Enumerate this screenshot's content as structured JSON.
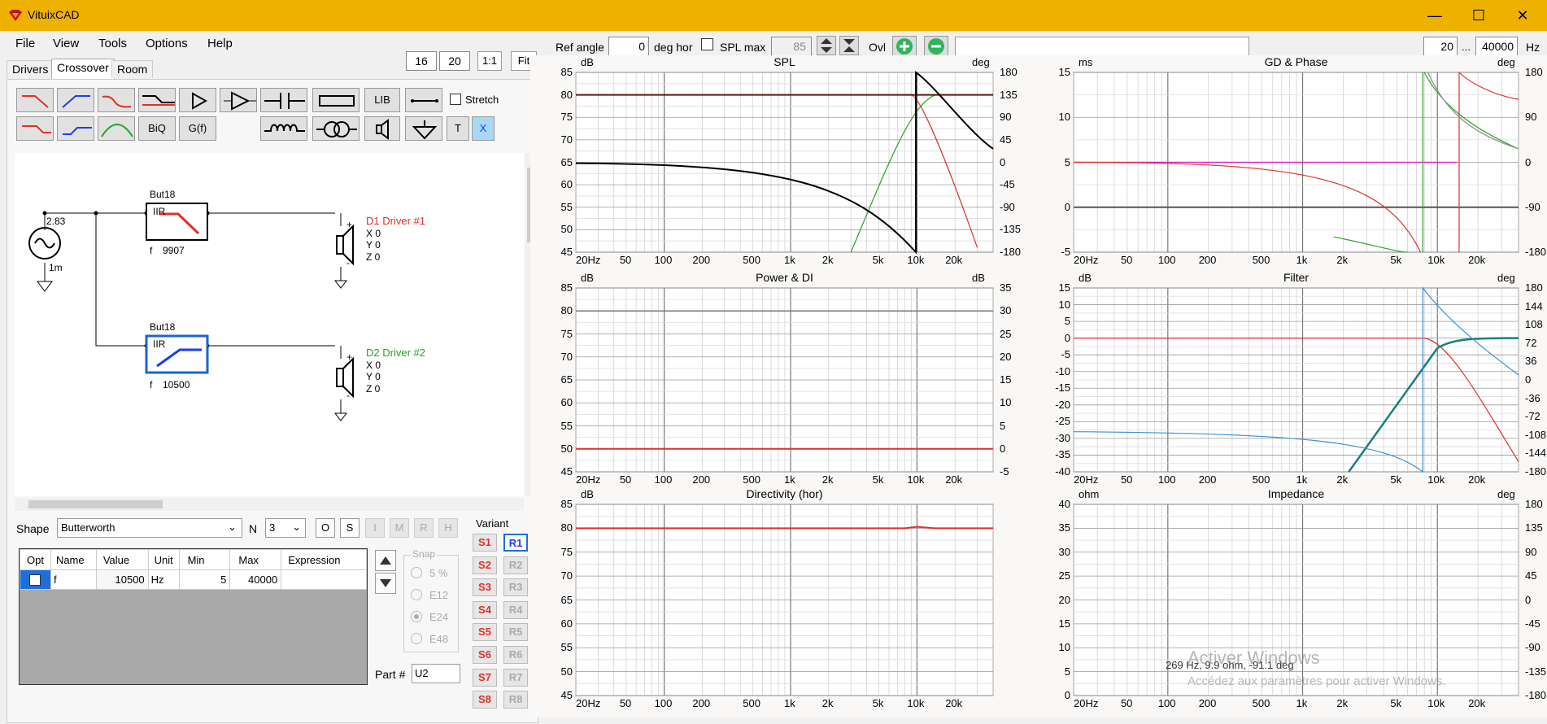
{
  "app": {
    "title": "VituixCAD"
  },
  "menu": [
    "File",
    "View",
    "Tools",
    "Options",
    "Help"
  ],
  "tabs": [
    "Drivers",
    "Crossover",
    "Room"
  ],
  "zoom": {
    "v1": "16",
    "v2": "20",
    "one": "1:1",
    "fit": "Fit"
  },
  "parts": {
    "lib": "LIB",
    "biq": "BiQ",
    "gf": "G(f)",
    "t": "T",
    "x": "X",
    "stretch": "Stretch"
  },
  "schematic": {
    "source_v": "2.83",
    "source_r": "1m",
    "block1": {
      "name": "But18",
      "type": "IIR",
      "f_label": "f",
      "f_value": "9907"
    },
    "block2": {
      "name": "But18",
      "type": "IIR",
      "f_label": "f",
      "f_value": "10500"
    },
    "driver1": {
      "name": "D1 Driver #1",
      "x": "X 0",
      "y": "Y 0",
      "z": "Z 0",
      "plus": "+",
      "minus": "-"
    },
    "driver2": {
      "name": "D2 Driver #2",
      "x": "X 0",
      "y": "Y 0",
      "z": "Z 0",
      "plus": "+",
      "minus": "-"
    }
  },
  "shape": {
    "label": "Shape",
    "value": "Butterworth",
    "n_label": "N",
    "n_value": "3",
    "btns": [
      "O",
      "S",
      "I",
      "M",
      "R",
      "H"
    ]
  },
  "table": {
    "headers": [
      "Opt",
      "Name",
      "Value",
      "Unit",
      "Min",
      "Max",
      "Expression"
    ],
    "row": {
      "name": "f",
      "value": "10500",
      "unit": "Hz",
      "min": "5",
      "max": "40000",
      "expr": ""
    }
  },
  "snap": {
    "label": "Snap",
    "options": [
      "5 %",
      "E12",
      "E24",
      "E48"
    ],
    "selected": "E24"
  },
  "part": {
    "label": "Part #",
    "value": "U2"
  },
  "variant": {
    "label": "Variant",
    "s": [
      "S1",
      "S2",
      "S3",
      "S4",
      "S5",
      "S6",
      "S7",
      "S8"
    ],
    "r": [
      "R1",
      "R2",
      "R3",
      "R4",
      "R5",
      "R6",
      "R7",
      "R8"
    ]
  },
  "top": {
    "ref_angle_label": "Ref angle",
    "ref_angle": "0",
    "deg_hor": "deg hor",
    "spl_max_label": "SPL max",
    "spl_max": "85",
    "ovl": "Ovl",
    "f_min": "20",
    "ellipsis": "...",
    "f_max": "40000",
    "hz": "Hz"
  },
  "x_ticks": [
    "20Hz",
    "50",
    "100",
    "200",
    "500",
    "1k",
    "2k",
    "5k",
    "10k",
    "20k"
  ],
  "panels": {
    "spl": {
      "title": "SPL",
      "lunit": "dB",
      "runit": "deg",
      "left": [
        "85",
        "80",
        "75",
        "70",
        "65",
        "60",
        "55",
        "50",
        "45"
      ],
      "right": [
        "180",
        "135",
        "90",
        "45",
        "0",
        "-45",
        "-90",
        "-135",
        "-180"
      ]
    },
    "gd": {
      "title": "GD & Phase",
      "lunit": "ms",
      "runit": "deg",
      "left": [
        "15",
        "10",
        "5",
        "0",
        "-5"
      ],
      "right": [
        "180",
        "90",
        "0",
        "-90",
        "-180"
      ]
    },
    "power": {
      "title": "Power & DI",
      "lunit": "dB",
      "runit": "dB",
      "left": [
        "85",
        "80",
        "75",
        "70",
        "65",
        "60",
        "55",
        "50",
        "45"
      ],
      "right": [
        "35",
        "30",
        "25",
        "20",
        "15",
        "10",
        "5",
        "0",
        "-5"
      ]
    },
    "filter": {
      "title": "Filter",
      "lunit": "dB",
      "runit": "deg",
      "left": [
        "15",
        "10",
        "5",
        "0",
        "-5",
        "-10",
        "-15",
        "-20",
        "-25",
        "-30",
        "-35",
        "-40"
      ],
      "right": [
        "180",
        "144",
        "108",
        "72",
        "36",
        "0",
        "-36",
        "-72",
        "-108",
        "-144",
        "-180"
      ]
    },
    "dir": {
      "title": "Directivity (hor)",
      "lunit": "dB",
      "runit": "",
      "left": [
        "85",
        "80",
        "75",
        "70",
        "65",
        "60",
        "55",
        "50",
        "45"
      ],
      "right": []
    },
    "imp": {
      "title": "Impedance",
      "lunit": "ohm",
      "runit": "deg",
      "left": [
        "40",
        "35",
        "30",
        "25",
        "20",
        "15",
        "10",
        "5",
        "0"
      ],
      "right": [
        "180",
        "135",
        "90",
        "45",
        "0",
        "-45",
        "-90",
        "-135",
        "-180"
      ]
    }
  },
  "readout": "269 Hz, 9.9 ohm, -91.1 deg",
  "watermark": {
    "line1": "Activer Windows",
    "line2": "Accédez aux paramètres pour activer Windows."
  },
  "colors": {
    "titlebar": "#efb100",
    "red": "#e0302a",
    "green": "#2aa02a",
    "blue": "#1a3ef0",
    "teal": "#1a7f7f"
  }
}
